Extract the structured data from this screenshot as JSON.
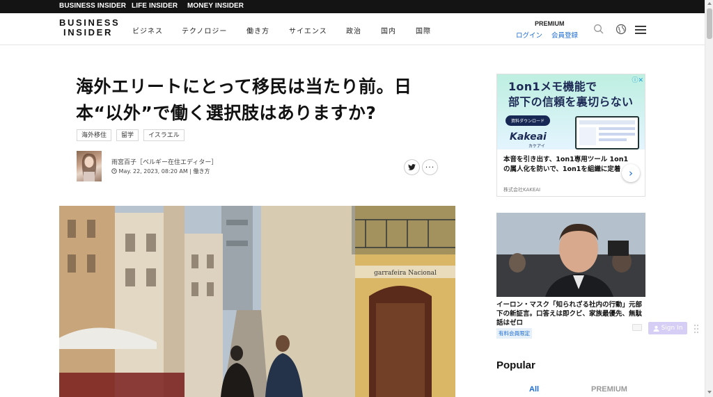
{
  "topbar": {
    "items": [
      "BUSINESS INSIDER",
      "LIFE INSIDER",
      "MONEY INSIDER"
    ]
  },
  "header": {
    "logo_line1": "BUSINESS",
    "logo_line2": "INSIDER",
    "nav": [
      "ビジネス",
      "テクノロジー",
      "働き方",
      "サイエンス",
      "政治",
      "国内",
      "国際"
    ],
    "premium": "PREMIUM",
    "login": "ログイン",
    "register": "会員登録"
  },
  "article": {
    "title": "海外エリートにとって移民は当たり前。日本“以外”で働く選択肢はありますか?",
    "tags": [
      "海外移住",
      "留学",
      "イスラエル"
    ],
    "author": "雨宮百子［ベルギー在住エディター］",
    "date": "May. 22, 2023, 08:20 AM",
    "category": "働き方"
  },
  "hero": {
    "sign": "garrafeira Nacional"
  },
  "ad": {
    "headline_line1": "1on1メモ機能で",
    "headline_line2": "部下の信頼を裏切らない",
    "download": "資料ダウンロード",
    "brand": "Kakeai",
    "brand_sub": "カケアイ",
    "description": "本音を引き出す、1on1専用ツール 1on1の属人化を防いで、1on1を組織に定着",
    "company": "株式会社KAKEAI"
  },
  "promo": {
    "text": "イーロン・マスク「知られざる社内の行動」元部下の新証言。口答えは即クビ、家族最優先、無駄話はゼロ",
    "badge": "有料会員限定"
  },
  "signin": {
    "label": "Sign In"
  },
  "popular": {
    "title": "Popular",
    "tabs": [
      "All",
      "PREMIUM"
    ]
  },
  "colors": {
    "accent": "#1a6ad1",
    "topbar": "#141414"
  }
}
